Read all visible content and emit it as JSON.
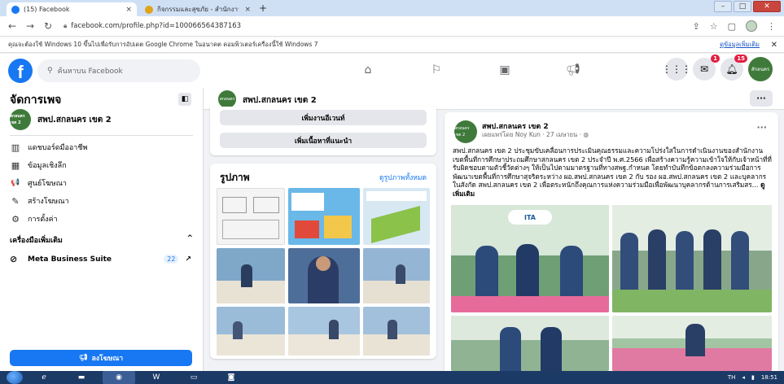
{
  "browser": {
    "tabs": [
      {
        "label": "(15) Facebook",
        "active": true
      },
      {
        "label": "กิจกรรมและสุขภัย - สำนักงานเขตพื้นที่",
        "active": false
      }
    ],
    "new_tab": "+",
    "url": "facebook.com/profile.php?id=100066564387163",
    "infobar_text": "คุณจะต้องใช้ Windows 10 ขึ้นไปเพื่อรับการอัปเดต Google Chrome ในอนาคต คอมพิวเตอร์เครื่องนี้ใช้ Windows 7",
    "infobar_link": "ดูข้อมูลเพิ่มเติม",
    "infobar_close": "✕"
  },
  "fbnav": {
    "logo": "f",
    "search_placeholder": "ค้นหาบน Facebook",
    "messenger_badge": "1",
    "notifications_badge": "15",
    "avatar_text": "สักลนคร"
  },
  "sidebar": {
    "title": "จัดการเพจ",
    "page_name": "สพป.สกลนคร เขต 2",
    "avatar_text": "สกลนคร เขต 2",
    "items": [
      {
        "label": "แดชบอร์ดมืออาชีพ",
        "icon": "dashboard-icon",
        "glyph": "▥"
      },
      {
        "label": "ข้อมูลเชิงลึก",
        "icon": "insights-icon",
        "glyph": "▦"
      },
      {
        "label": "ศูนย์โฆษณา",
        "icon": "megaphone-icon",
        "glyph": "📢"
      },
      {
        "label": "สร้างโฆษณา",
        "icon": "pencil-icon",
        "glyph": "✎"
      },
      {
        "label": "การตั้งค่า",
        "icon": "gear-icon",
        "glyph": "⚙"
      }
    ],
    "tools_label": "เครื่องมือเพิ่มเติม",
    "tools_toggle": "^",
    "meta_label": "Meta Business Suite",
    "meta_count": "22",
    "meta_arrow": "↗",
    "promote_label": "ลงโฆษณา"
  },
  "page_header": {
    "name": "สพป.สกลนคร เขต 2",
    "avatar_text": "สกลนคร",
    "more": "···"
  },
  "middle": {
    "btn_live": "เพิ่มงานอีเวนท์",
    "btn_featured": "เพิ่มเนื้อหาที่แนะนำ",
    "photos_title": "รูปภาพ",
    "photos_all": "ดูรูปภาพทั้งหมด"
  },
  "post": {
    "page_name": "สพป.สกลนคร เขต 2",
    "meta": "เผยแพร่โดย Noy Kun · 27 เมษายน ·",
    "avatar_text": "สกลนคร เขต 2",
    "more": "···",
    "text": "สพป.สกลนคร เขต 2 ประชุมขับเคลื่อนการประเมินคุณธรรมและความโปร่งใสในการดำเนินงานของสำนักงานเขตพื้นที่การศึกษาประถมศึกษาสกลนคร เขต 2 ประจำปี พ.ศ.2566 เพื่อสร้างความรู้ความเข้าใจให้กับเจ้าหน้าที่ที่รับผิดชอบตามตัวชี้วัดต่างๆ ให้เป็นไปตามมาตรฐานที่ทางสพฐ.กำหนด โดยทำบันทึกข้อตกลงความร่วมมือการพัฒนาเขตพื้นที่การศึกษาสุจริตระหว่าง ผอ.สพป.สกลนคร เขต 2 กับ รอง ผอ.สพป.สกลนคร เขต 2 และบุคลากรในสังกัด สพป.สกลนคร เขต 2 เพื่อตระหนักถึงคุณการแห่งความร่วมมือเพื่อพัฒนาบุคลากรด้านการเสริมสร...",
    "see_more": "ดูเพิ่มเติม",
    "ita_label": "ITA"
  },
  "taskbar": {
    "lang": "TH",
    "time": "18:51"
  },
  "colors": {
    "fb_blue": "#1877f2",
    "page_green": "#3f7a3a",
    "taskbar": "#1c3a66"
  }
}
